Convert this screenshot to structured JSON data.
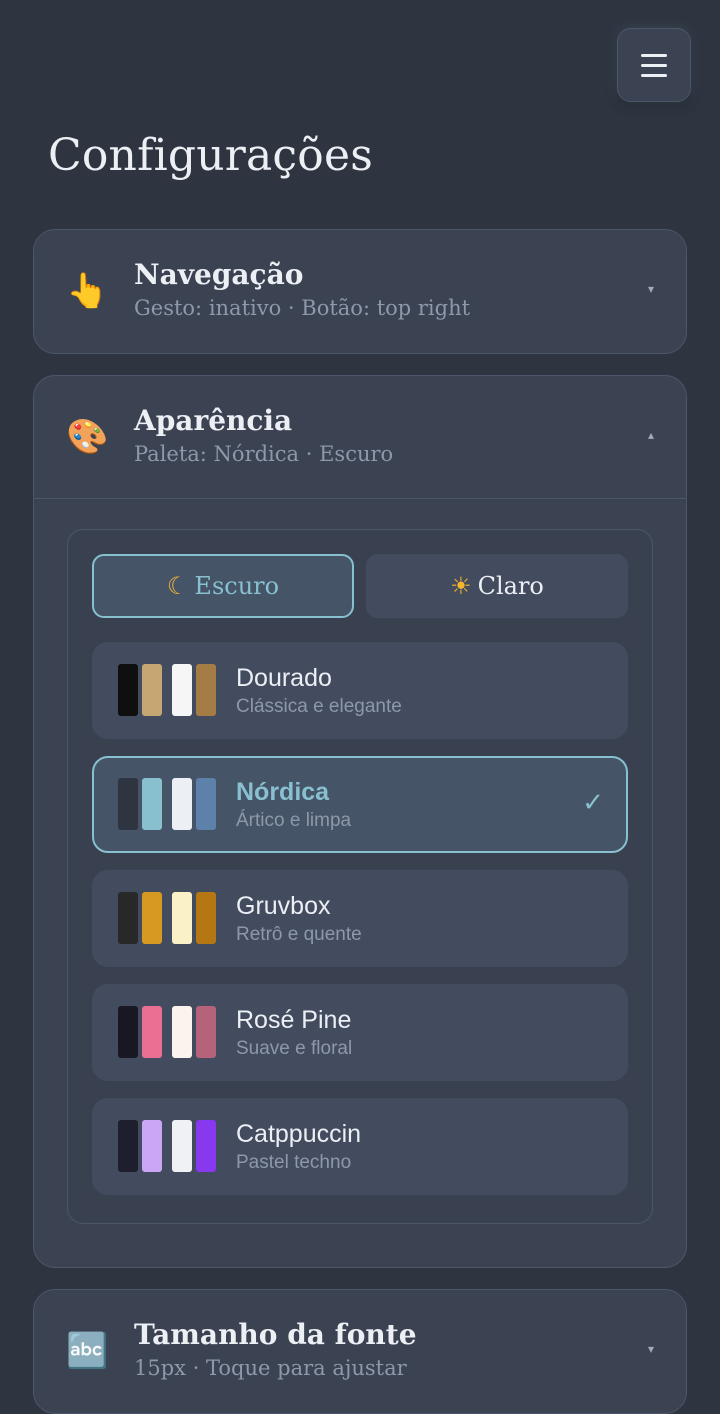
{
  "header": {
    "menu_icon": "hamburger-menu-icon",
    "title": "Configurações"
  },
  "sections": {
    "navigation": {
      "icon": "👆",
      "icon_name": "pointing-hand-icon",
      "title": "Navegação",
      "subtitle": "Gesto: inativo · Botão: top right",
      "chevron": "▾",
      "expanded": false
    },
    "appearance": {
      "icon": "🎨",
      "icon_name": "palette-icon",
      "title": "Aparência",
      "subtitle": "Paleta: Nórdica · Escuro",
      "chevron": "▴",
      "expanded": true,
      "modes": {
        "dark": {
          "icon": "☾",
          "label": "Escuro",
          "active": true
        },
        "light": {
          "icon": "☀",
          "label": "Claro",
          "active": false
        }
      },
      "palettes": [
        {
          "name": "Dourado",
          "description": "Clássica e elegante",
          "selected": false,
          "swatches": [
            "#0f0f10",
            "#c6a672",
            "#f6f6f6",
            "#a57b46"
          ]
        },
        {
          "name": "Nórdica",
          "description": "Ártico e limpa",
          "selected": true,
          "swatches": [
            "#2e3440",
            "#88c0d0",
            "#eceff4",
            "#5e81ac"
          ]
        },
        {
          "name": "Gruvbox",
          "description": "Retrô e quente",
          "selected": false,
          "swatches": [
            "#282828",
            "#d79921",
            "#fbf1c7",
            "#b57614"
          ]
        },
        {
          "name": "Rosé Pine",
          "description": "Suave e floral",
          "selected": false,
          "swatches": [
            "#191724",
            "#eb6f92",
            "#faf4ed",
            "#b4637a"
          ]
        },
        {
          "name": "Catppuccin",
          "description": "Pastel techno",
          "selected": false,
          "swatches": [
            "#1e1e2e",
            "#cba6f7",
            "#eff1f5",
            "#8839ef"
          ]
        }
      ],
      "check_icon": "✓"
    },
    "font_size": {
      "icon": "🔤",
      "icon_name": "abc-icon",
      "title": "Tamanho da fonte",
      "subtitle": "15px · Toque para ajustar",
      "chevron": "▾",
      "expanded": false
    }
  },
  "colors": {
    "background": "#2e3440",
    "card": "#3b4252",
    "accent": "#88c0d0",
    "muted_text": "#8e98ab"
  }
}
